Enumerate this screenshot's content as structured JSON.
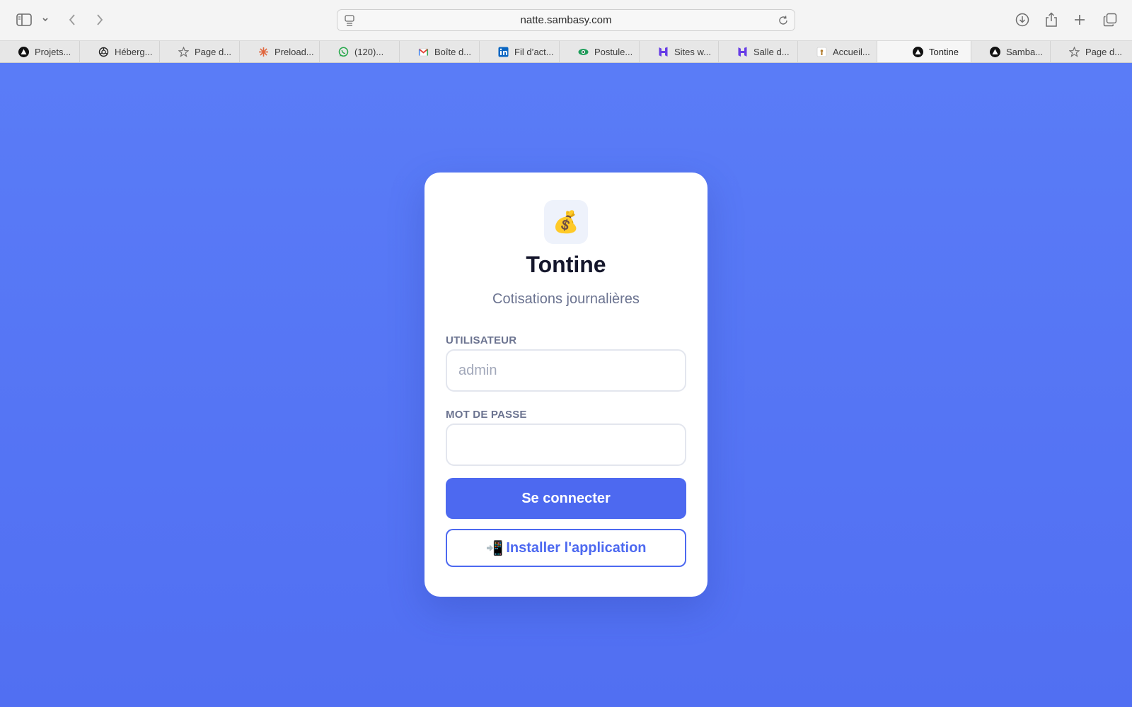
{
  "browser": {
    "url": "natte.sambasy.com",
    "tabs": [
      {
        "label": "Projets...",
        "icon": "triangle-logo-icon"
      },
      {
        "label": "Héberg...",
        "icon": "openai-logo-icon"
      },
      {
        "label": "Page d...",
        "icon": "star-icon"
      },
      {
        "label": "Preload...",
        "icon": "asterisk-logo-icon"
      },
      {
        "label": "(120)...",
        "icon": "whatsapp-icon"
      },
      {
        "label": "Boîte d...",
        "icon": "gmail-icon"
      },
      {
        "label": "Fil d’act...",
        "icon": "linkedin-icon"
      },
      {
        "label": "Postule...",
        "icon": "eye-logo-icon"
      },
      {
        "label": "Sites w...",
        "icon": "hostinger-icon"
      },
      {
        "label": "Salle d...",
        "icon": "hostinger-icon"
      },
      {
        "label": "Accueil...",
        "icon": "site-favicon-icon"
      },
      {
        "label": "Tontine",
        "icon": "triangle-logo-icon",
        "active": true
      },
      {
        "label": "Samba...",
        "icon": "triangle-logo-icon"
      },
      {
        "label": "Page d...",
        "icon": "star-icon"
      }
    ]
  },
  "login": {
    "logo_emoji": "💰",
    "title": "Tontine",
    "subtitle": "Cotisations journalières",
    "username_label": "UTILISATEUR",
    "username_placeholder": "admin",
    "username_value": "",
    "password_label": "MOT DE PASSE",
    "password_value": "",
    "submit_label": "Se connecter",
    "install_icon": "📲",
    "install_label": "Installer l'application"
  },
  "colors": {
    "background": "#5a7cf7",
    "accent": "#4d69f0",
    "title": "#14162b",
    "muted": "#6b7390"
  }
}
